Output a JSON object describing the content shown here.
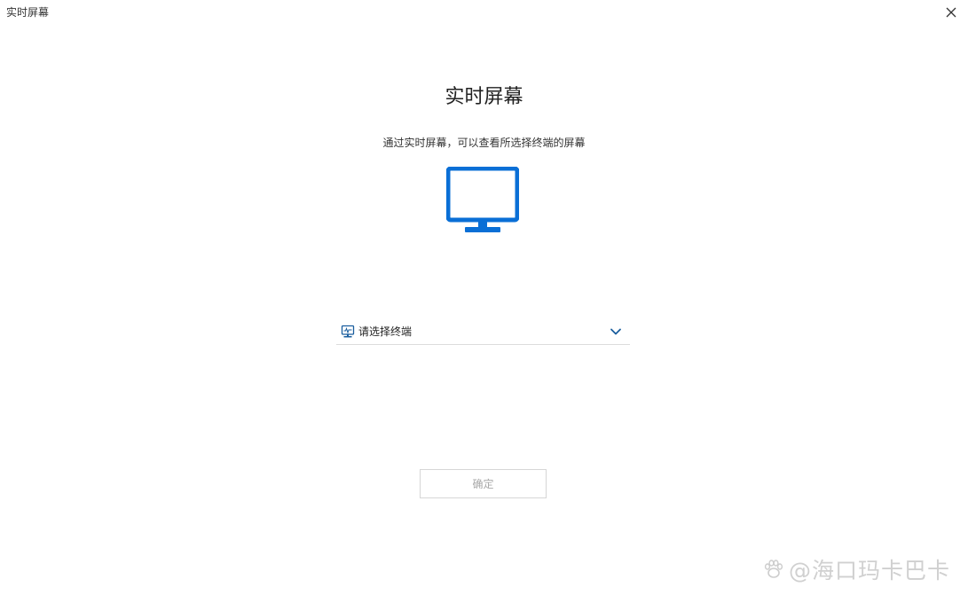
{
  "window": {
    "title": "实时屏幕"
  },
  "main": {
    "heading": "实时屏幕",
    "subtitle": "通过实时屏幕，可以查看所选择终端的屏幕",
    "illustration_icon": "monitor-icon"
  },
  "terminal_select": {
    "placeholder": "请选择终端",
    "icon": "terminal-icon",
    "chevron": "chevron-down-icon"
  },
  "actions": {
    "confirm_label": "确定"
  },
  "watermark": {
    "text": "@海口玛卡巴卡"
  },
  "colors": {
    "accent": "#0a6fd6",
    "chevron": "#1a5e9e",
    "divider": "#dcdcdc",
    "disabled_text": "#a8a8a8"
  }
}
